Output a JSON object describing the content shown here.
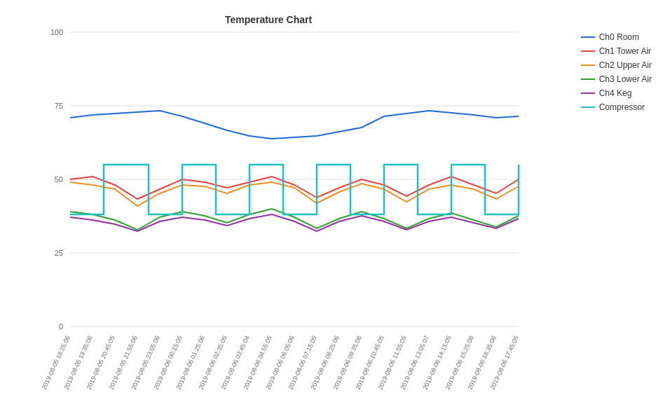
{
  "chart": {
    "title": "Temperature Chart",
    "yAxis": {
      "max": 100,
      "ticks": [
        0,
        25,
        50,
        75,
        100
      ]
    },
    "xLabels": [
      "2019-08-05 18:25:06",
      "2019-08-05 19:35:06",
      "2019-08-05 20:45:05",
      "2019-08-05 21:55:06",
      "2019-08-05 23:05:06",
      "2019-08-06 00:15:05",
      "2019-08-06 01:25:06",
      "2019-08-06 02:35:05",
      "2019-08-06 03:45:04",
      "2019-08-06 04:55:05",
      "2019-08-06 06:05:06",
      "2019-08-06 07:15:05",
      "2019-08-06 08:25:06",
      "2019-08-06 09:35:06",
      "2019-08-06 10:45:05",
      "2019-08-06 11:55:05",
      "2019-08-06 13:05:07",
      "2019-08-06 14:15:05",
      "2019-08-06 15:25:06",
      "2019-08-06 16:35:06",
      "2019-08-06 17:45:05"
    ],
    "legend": [
      {
        "label": "Ch0 Room",
        "color": "#1f6bdb"
      },
      {
        "label": "Ch1 Tower Air",
        "color": "#e84040"
      },
      {
        "label": "Ch2 Upper Air",
        "color": "#e89020"
      },
      {
        "label": "Ch3 Lower Air",
        "color": "#30a030"
      },
      {
        "label": "Ch4 Keg",
        "color": "#9030a0"
      },
      {
        "label": "Compressor",
        "color": "#20c0c0"
      }
    ]
  }
}
